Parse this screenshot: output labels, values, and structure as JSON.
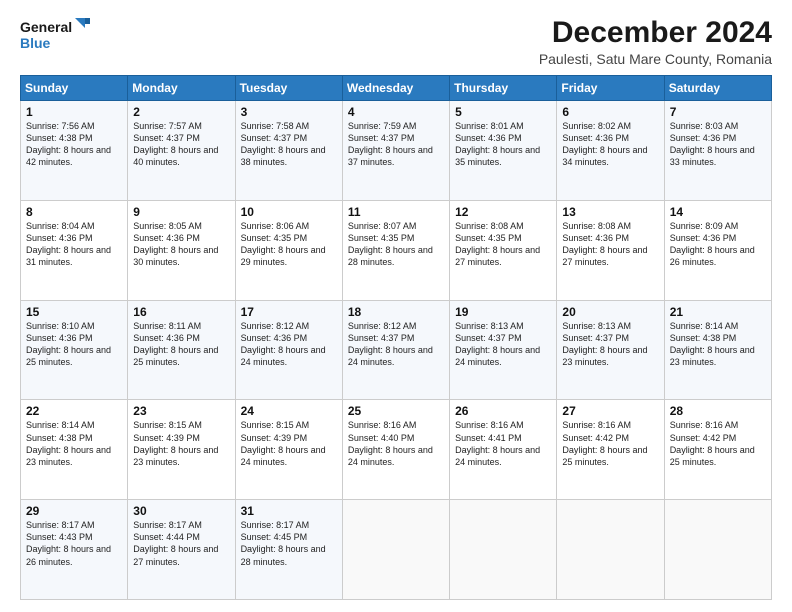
{
  "header": {
    "logo_line1": "General",
    "logo_line2": "Blue",
    "title": "December 2024",
    "subtitle": "Paulesti, Satu Mare County, Romania"
  },
  "days_of_week": [
    "Sunday",
    "Monday",
    "Tuesday",
    "Wednesday",
    "Thursday",
    "Friday",
    "Saturday"
  ],
  "weeks": [
    [
      {
        "day": "1",
        "sunrise": "Sunrise: 7:56 AM",
        "sunset": "Sunset: 4:38 PM",
        "daylight": "Daylight: 8 hours and 42 minutes."
      },
      {
        "day": "2",
        "sunrise": "Sunrise: 7:57 AM",
        "sunset": "Sunset: 4:37 PM",
        "daylight": "Daylight: 8 hours and 40 minutes."
      },
      {
        "day": "3",
        "sunrise": "Sunrise: 7:58 AM",
        "sunset": "Sunset: 4:37 PM",
        "daylight": "Daylight: 8 hours and 38 minutes."
      },
      {
        "day": "4",
        "sunrise": "Sunrise: 7:59 AM",
        "sunset": "Sunset: 4:37 PM",
        "daylight": "Daylight: 8 hours and 37 minutes."
      },
      {
        "day": "5",
        "sunrise": "Sunrise: 8:01 AM",
        "sunset": "Sunset: 4:36 PM",
        "daylight": "Daylight: 8 hours and 35 minutes."
      },
      {
        "day": "6",
        "sunrise": "Sunrise: 8:02 AM",
        "sunset": "Sunset: 4:36 PM",
        "daylight": "Daylight: 8 hours and 34 minutes."
      },
      {
        "day": "7",
        "sunrise": "Sunrise: 8:03 AM",
        "sunset": "Sunset: 4:36 PM",
        "daylight": "Daylight: 8 hours and 33 minutes."
      }
    ],
    [
      {
        "day": "8",
        "sunrise": "Sunrise: 8:04 AM",
        "sunset": "Sunset: 4:36 PM",
        "daylight": "Daylight: 8 hours and 31 minutes."
      },
      {
        "day": "9",
        "sunrise": "Sunrise: 8:05 AM",
        "sunset": "Sunset: 4:36 PM",
        "daylight": "Daylight: 8 hours and 30 minutes."
      },
      {
        "day": "10",
        "sunrise": "Sunrise: 8:06 AM",
        "sunset": "Sunset: 4:35 PM",
        "daylight": "Daylight: 8 hours and 29 minutes."
      },
      {
        "day": "11",
        "sunrise": "Sunrise: 8:07 AM",
        "sunset": "Sunset: 4:35 PM",
        "daylight": "Daylight: 8 hours and 28 minutes."
      },
      {
        "day": "12",
        "sunrise": "Sunrise: 8:08 AM",
        "sunset": "Sunset: 4:35 PM",
        "daylight": "Daylight: 8 hours and 27 minutes."
      },
      {
        "day": "13",
        "sunrise": "Sunrise: 8:08 AM",
        "sunset": "Sunset: 4:36 PM",
        "daylight": "Daylight: 8 hours and 27 minutes."
      },
      {
        "day": "14",
        "sunrise": "Sunrise: 8:09 AM",
        "sunset": "Sunset: 4:36 PM",
        "daylight": "Daylight: 8 hours and 26 minutes."
      }
    ],
    [
      {
        "day": "15",
        "sunrise": "Sunrise: 8:10 AM",
        "sunset": "Sunset: 4:36 PM",
        "daylight": "Daylight: 8 hours and 25 minutes."
      },
      {
        "day": "16",
        "sunrise": "Sunrise: 8:11 AM",
        "sunset": "Sunset: 4:36 PM",
        "daylight": "Daylight: 8 hours and 25 minutes."
      },
      {
        "day": "17",
        "sunrise": "Sunrise: 8:12 AM",
        "sunset": "Sunset: 4:36 PM",
        "daylight": "Daylight: 8 hours and 24 minutes."
      },
      {
        "day": "18",
        "sunrise": "Sunrise: 8:12 AM",
        "sunset": "Sunset: 4:37 PM",
        "daylight": "Daylight: 8 hours and 24 minutes."
      },
      {
        "day": "19",
        "sunrise": "Sunrise: 8:13 AM",
        "sunset": "Sunset: 4:37 PM",
        "daylight": "Daylight: 8 hours and 24 minutes."
      },
      {
        "day": "20",
        "sunrise": "Sunrise: 8:13 AM",
        "sunset": "Sunset: 4:37 PM",
        "daylight": "Daylight: 8 hours and 23 minutes."
      },
      {
        "day": "21",
        "sunrise": "Sunrise: 8:14 AM",
        "sunset": "Sunset: 4:38 PM",
        "daylight": "Daylight: 8 hours and 23 minutes."
      }
    ],
    [
      {
        "day": "22",
        "sunrise": "Sunrise: 8:14 AM",
        "sunset": "Sunset: 4:38 PM",
        "daylight": "Daylight: 8 hours and 23 minutes."
      },
      {
        "day": "23",
        "sunrise": "Sunrise: 8:15 AM",
        "sunset": "Sunset: 4:39 PM",
        "daylight": "Daylight: 8 hours and 23 minutes."
      },
      {
        "day": "24",
        "sunrise": "Sunrise: 8:15 AM",
        "sunset": "Sunset: 4:39 PM",
        "daylight": "Daylight: 8 hours and 24 minutes."
      },
      {
        "day": "25",
        "sunrise": "Sunrise: 8:16 AM",
        "sunset": "Sunset: 4:40 PM",
        "daylight": "Daylight: 8 hours and 24 minutes."
      },
      {
        "day": "26",
        "sunrise": "Sunrise: 8:16 AM",
        "sunset": "Sunset: 4:41 PM",
        "daylight": "Daylight: 8 hours and 24 minutes."
      },
      {
        "day": "27",
        "sunrise": "Sunrise: 8:16 AM",
        "sunset": "Sunset: 4:42 PM",
        "daylight": "Daylight: 8 hours and 25 minutes."
      },
      {
        "day": "28",
        "sunrise": "Sunrise: 8:16 AM",
        "sunset": "Sunset: 4:42 PM",
        "daylight": "Daylight: 8 hours and 25 minutes."
      }
    ],
    [
      {
        "day": "29",
        "sunrise": "Sunrise: 8:17 AM",
        "sunset": "Sunset: 4:43 PM",
        "daylight": "Daylight: 8 hours and 26 minutes."
      },
      {
        "day": "30",
        "sunrise": "Sunrise: 8:17 AM",
        "sunset": "Sunset: 4:44 PM",
        "daylight": "Daylight: 8 hours and 27 minutes."
      },
      {
        "day": "31",
        "sunrise": "Sunrise: 8:17 AM",
        "sunset": "Sunset: 4:45 PM",
        "daylight": "Daylight: 8 hours and 28 minutes."
      },
      null,
      null,
      null,
      null
    ]
  ]
}
